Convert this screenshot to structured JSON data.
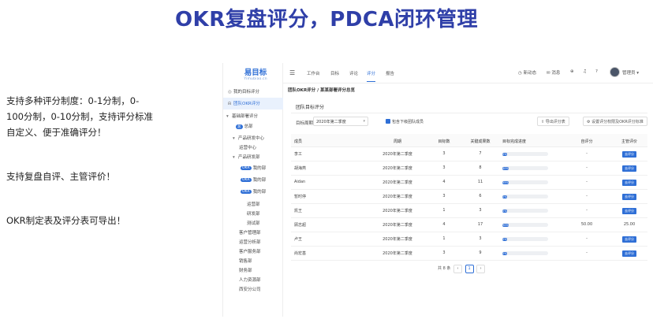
{
  "headline": "OKR复盘评分，PDCA闭环管理",
  "features": {
    "f1": "支持多种评分制度：0-1分制，0-100分制，0-10分制，支持评分标准自定义、便于准确评分！",
    "f2": "支持复盘自评、主管评价！",
    "f3": "OKR制定表及评分表可导出！"
  },
  "app": {
    "logo_title": "易目标",
    "logo_sub": "Yimubiao.cn",
    "sidebar": {
      "item1": "我的目标评分",
      "item2": "团队OKR评分",
      "group": "基础部署评分",
      "sub1": "总部",
      "sub2": "产品研发中心",
      "sub3": "运营中心",
      "sub4": "产品研发部",
      "pill1": "OKR",
      "sub5": "我的部",
      "pill2": "OKR",
      "sub6": "我的部",
      "pill3": "OKR",
      "sub7": "我的部",
      "sub8": "运营部",
      "sub9": "研发部",
      "sub10": "测试部",
      "sub11": "客户管理部",
      "sub12": "运营分析部",
      "sub13": "客户服务部",
      "sub14": "销售部",
      "sub15": "财务部",
      "sub16": "人力资源部",
      "sub17": "西安分公司"
    },
    "topbar": {
      "n1": "工作台",
      "n2": "目标",
      "n3": "评论",
      "n4": "评分",
      "n5": "报告",
      "r1": "新动态",
      "r2": "消息",
      "user": "管理员"
    },
    "breadcrumb": "团队OKR评分 / 某某部署评分总览",
    "section_title": "团队目标评分",
    "filter": {
      "label": "目标周期",
      "value": "2020年第二季度",
      "check_label": "包含下级团队成员",
      "btn1": "导出评分表",
      "btn2": "设置评分权限及OKR评分标准"
    },
    "columns": {
      "name": "成员",
      "period": "周期",
      "obj": "目标数",
      "kr": "关键成果数",
      "prog": "目标完成进度",
      "self": "自评分",
      "mgr": "主管评价"
    },
    "rows": [
      {
        "name": "李工",
        "period": "2020年第二季度",
        "obj": "3",
        "kr": "7",
        "progress": 0.0,
        "prog_label": "0%",
        "self": "-",
        "mgr": "去评分"
      },
      {
        "name": "胡海燕",
        "period": "2020年第二季度",
        "obj": "3",
        "kr": "8",
        "progress": 0.4,
        "prog_label": "40%",
        "self": "-",
        "mgr": "去评分"
      },
      {
        "name": "Aidan",
        "period": "2020年第二季度",
        "obj": "4",
        "kr": "11",
        "progress": 0.95,
        "prog_label": "95%",
        "self": "-",
        "mgr": "去评分"
      },
      {
        "name": "暂时停",
        "period": "2020年第二季度",
        "obj": "3",
        "kr": "6",
        "progress": 0.0,
        "prog_label": "0%",
        "self": "-",
        "mgr": "去评分"
      },
      {
        "name": "凯王",
        "period": "2020年第二季度",
        "obj": "1",
        "kr": "3",
        "progress": 0.0,
        "prog_label": "0%",
        "self": "-",
        "mgr": "去评分"
      },
      {
        "name": "顾志超",
        "period": "2020年第二季度",
        "obj": "4",
        "kr": "17",
        "progress": 0.9,
        "prog_label": "90%",
        "self": "50.00",
        "mgr": "25.00"
      },
      {
        "name": "卢王",
        "period": "2020年第二季度",
        "obj": "1",
        "kr": "3",
        "progress": 0.0,
        "prog_label": "0%",
        "self": "-",
        "mgr": "去评分"
      },
      {
        "name": "尚宏基",
        "period": "2020年第二季度",
        "obj": "3",
        "kr": "9",
        "progress": 0.0,
        "prog_label": "0%",
        "self": "-",
        "mgr": "去评分"
      }
    ],
    "pager": {
      "total": "共 8 条",
      "prev": "‹",
      "page": "1",
      "next": "›"
    }
  }
}
